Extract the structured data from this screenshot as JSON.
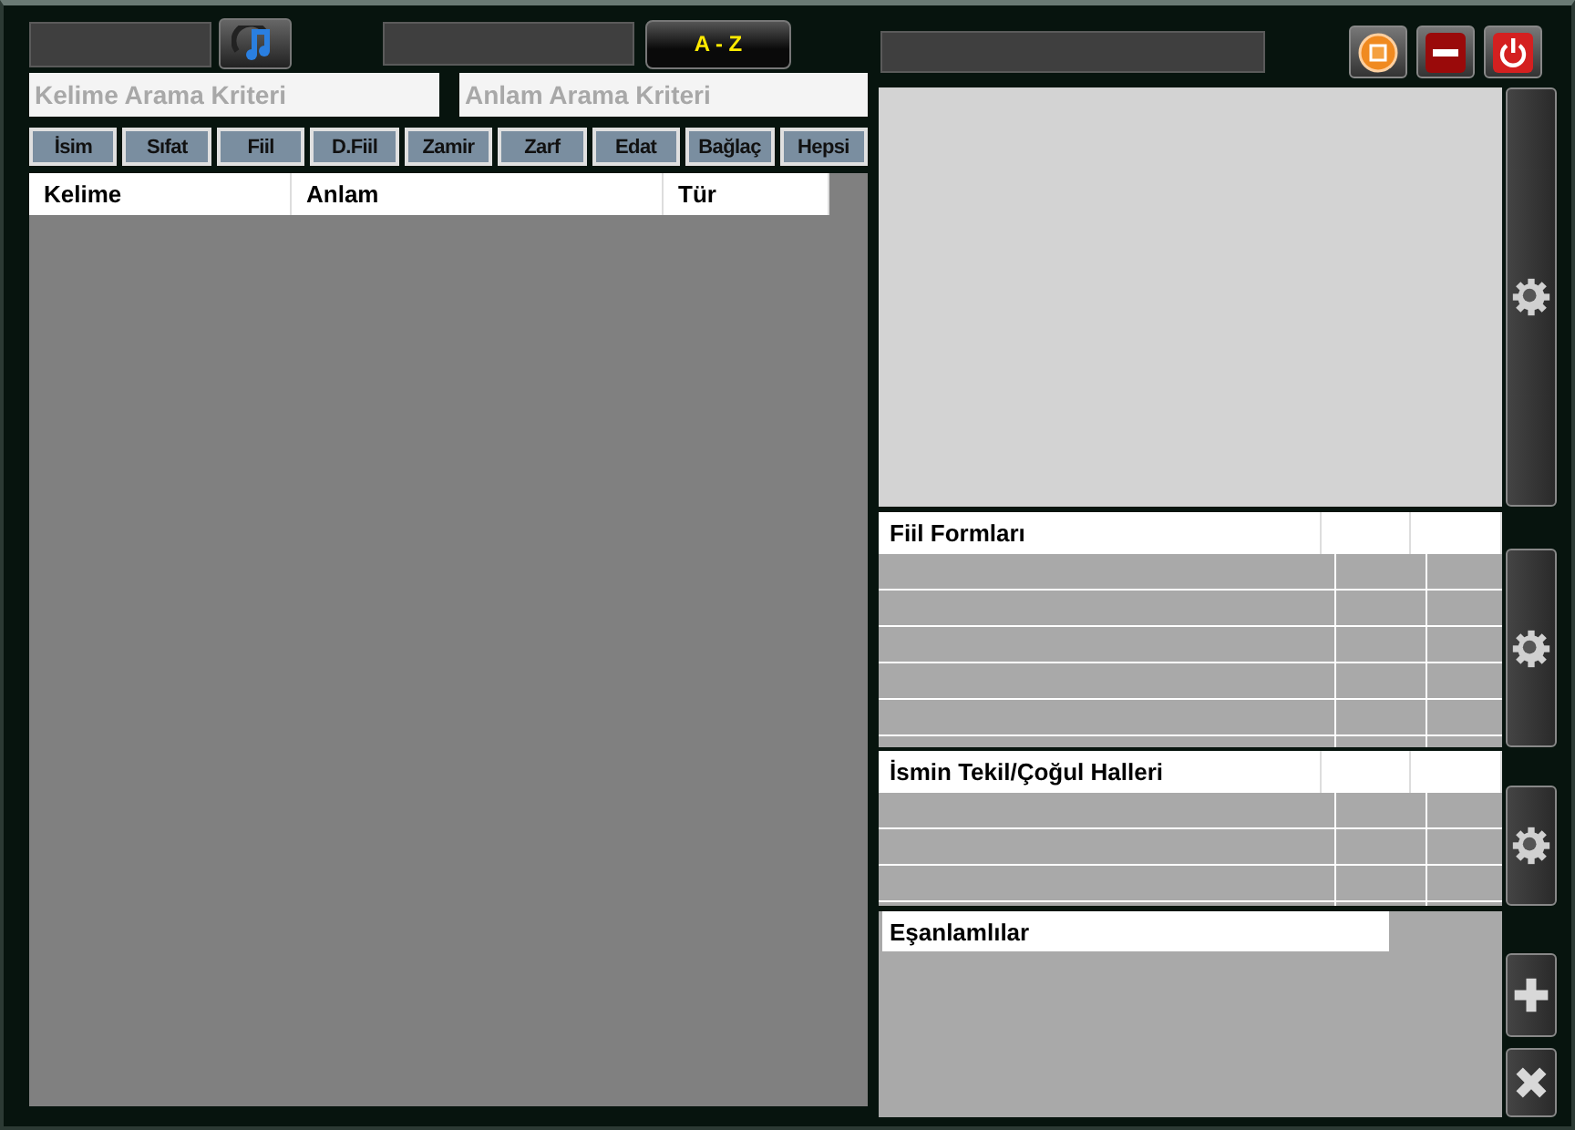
{
  "toolbar": {
    "sort_button": "A - Z"
  },
  "search": {
    "word_placeholder": "Kelime Arama Kriteri",
    "meaning_placeholder": "Anlam Arama Kriteri"
  },
  "filters": [
    "İsim",
    "Sıfat",
    "Fiil",
    "D.Fiil",
    "Zamir",
    "Zarf",
    "Edat",
    "Bağlaç",
    "Hepsi"
  ],
  "table": {
    "columns": [
      "Kelime",
      "Anlam",
      "Tür"
    ]
  },
  "window_buttons": [
    {
      "kind": "stop"
    },
    {
      "kind": "minimize"
    },
    {
      "kind": "power"
    }
  ],
  "verb_forms": {
    "title": "Fiil Formları"
  },
  "noun_forms": {
    "title": "İsmin Tekil/Çoğul Halleri"
  },
  "synonyms": {
    "title": "Eşanlamlılar"
  },
  "side_buttons": [
    {
      "kind": "settings"
    },
    {
      "kind": "settings"
    },
    {
      "kind": "settings"
    },
    {
      "kind": "add"
    },
    {
      "kind": "delete"
    }
  ]
}
